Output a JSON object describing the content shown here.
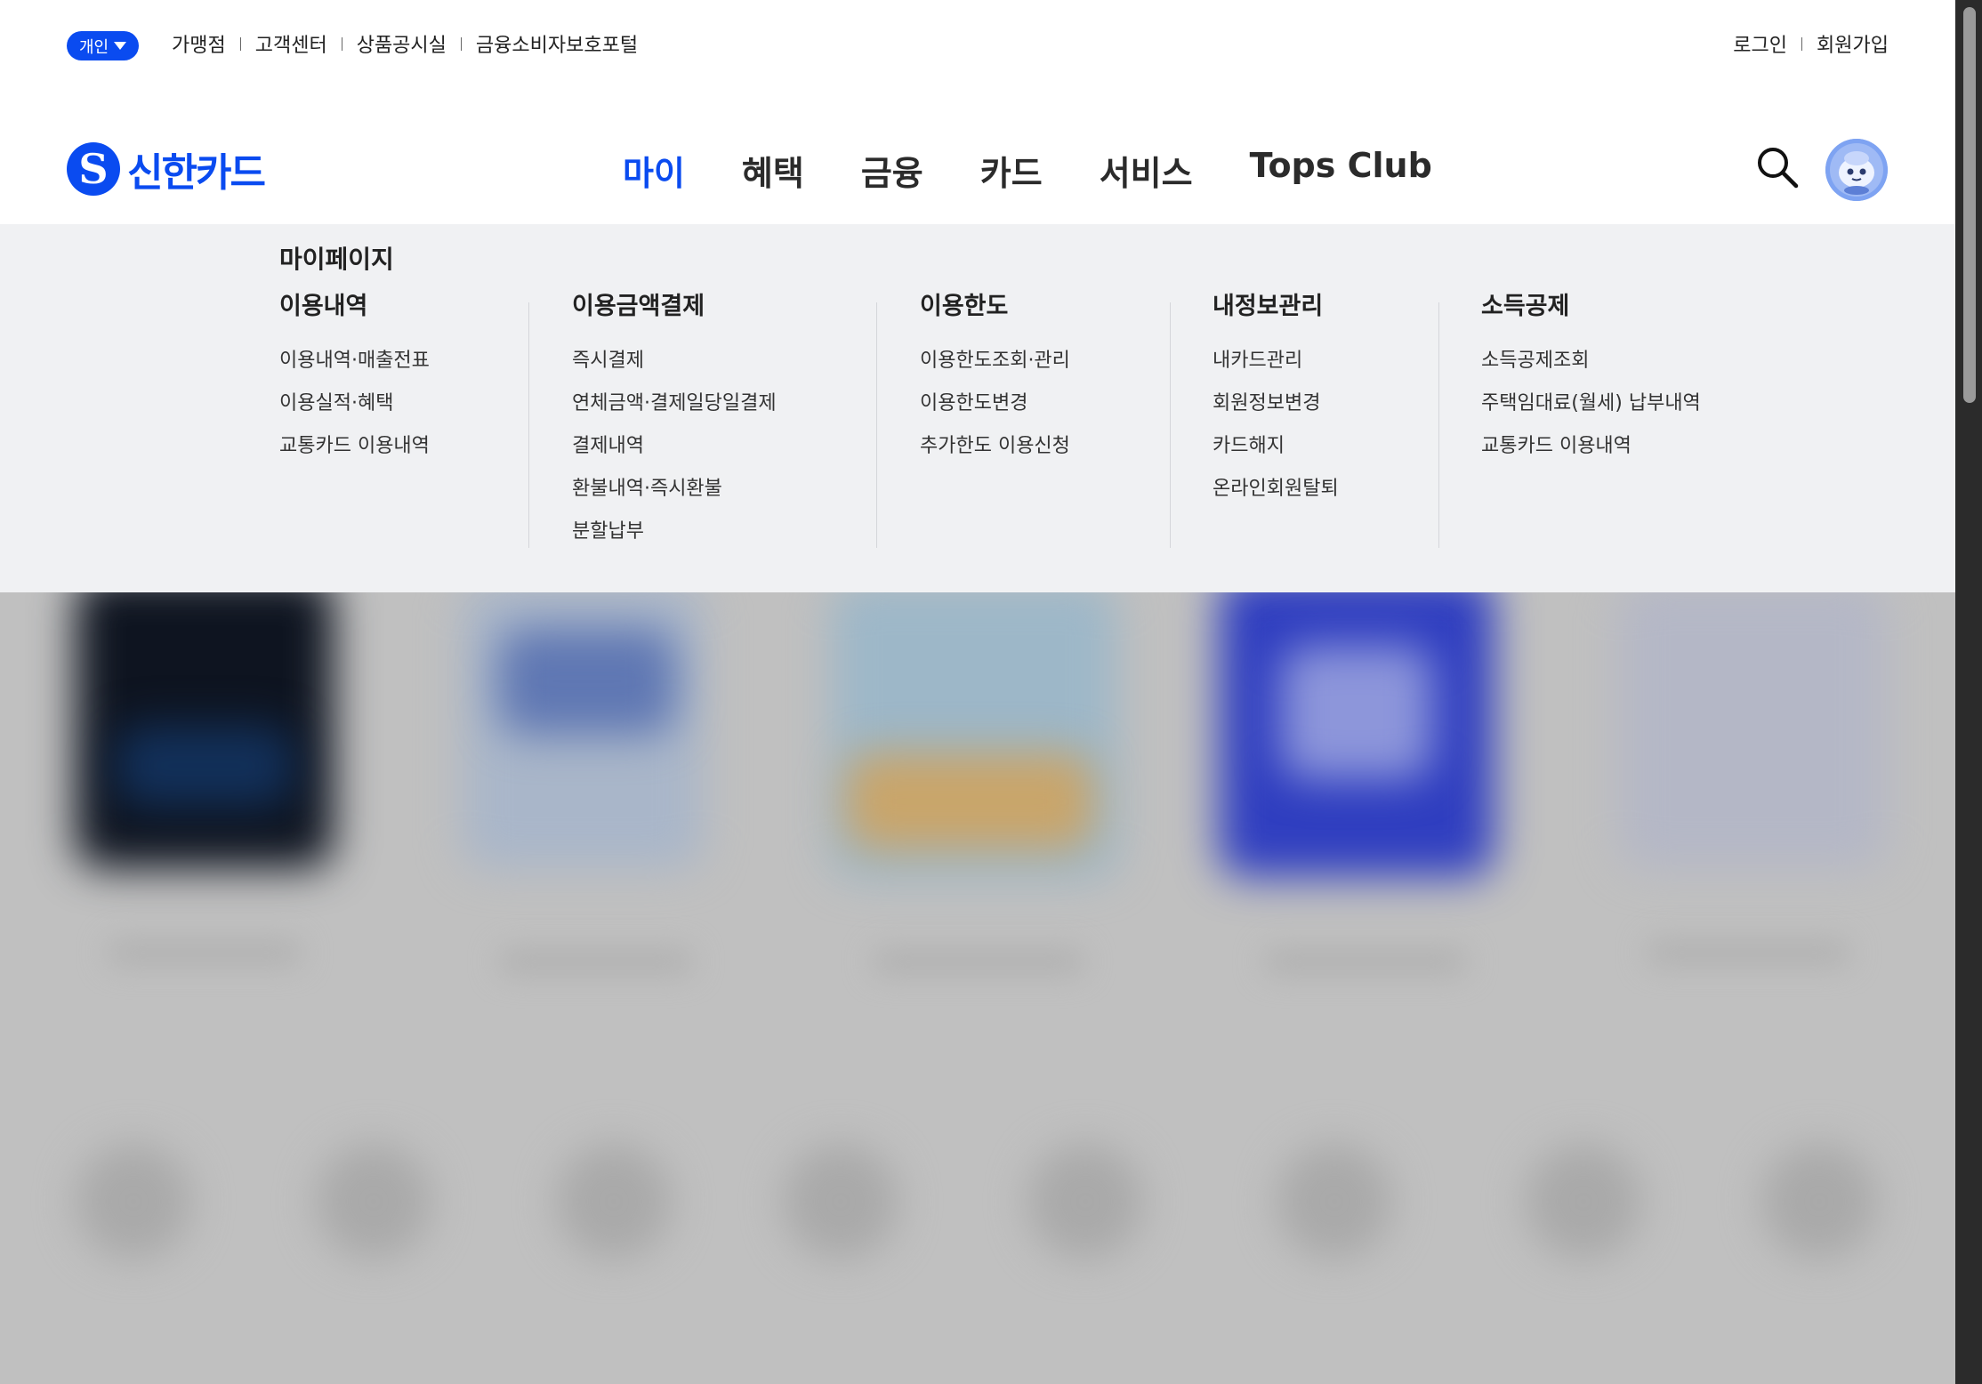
{
  "header": {
    "segment_label": "개인",
    "util_links": [
      "가맹점",
      "고객센터",
      "상품공시실",
      "금융소비자보호포털"
    ],
    "auth_links": [
      "로그인",
      "회원가입"
    ]
  },
  "brand": {
    "logo_text": "신한카드",
    "accent_color": "#0a4bf0"
  },
  "nav": {
    "items": [
      "마이",
      "혜택",
      "금융",
      "카드",
      "서비스",
      "Tops Club"
    ],
    "active": "마이"
  },
  "mega_menu": {
    "title": "마이페이지",
    "columns": [
      {
        "heading": "이용내역",
        "items": [
          "이용내역·매출전표",
          "이용실적·혜택",
          "교통카드 이용내역"
        ]
      },
      {
        "heading": "이용금액결제",
        "items": [
          "즉시결제",
          "연체금액·결제일당일결제",
          "결제내역",
          "환불내역·즉시환불",
          "분할납부"
        ]
      },
      {
        "heading": "이용한도",
        "items": [
          "이용한도조회·관리",
          "이용한도변경",
          "추가한도 이용신청"
        ]
      },
      {
        "heading": "내정보관리",
        "items": [
          "내카드관리",
          "회원정보변경",
          "카드해지",
          "온라인회원탈퇴"
        ]
      },
      {
        "heading": "소득공제",
        "items": [
          "소득공제조회",
          "주택임대료(월세) 납부내역",
          "교통카드 이용내역"
        ]
      }
    ]
  }
}
